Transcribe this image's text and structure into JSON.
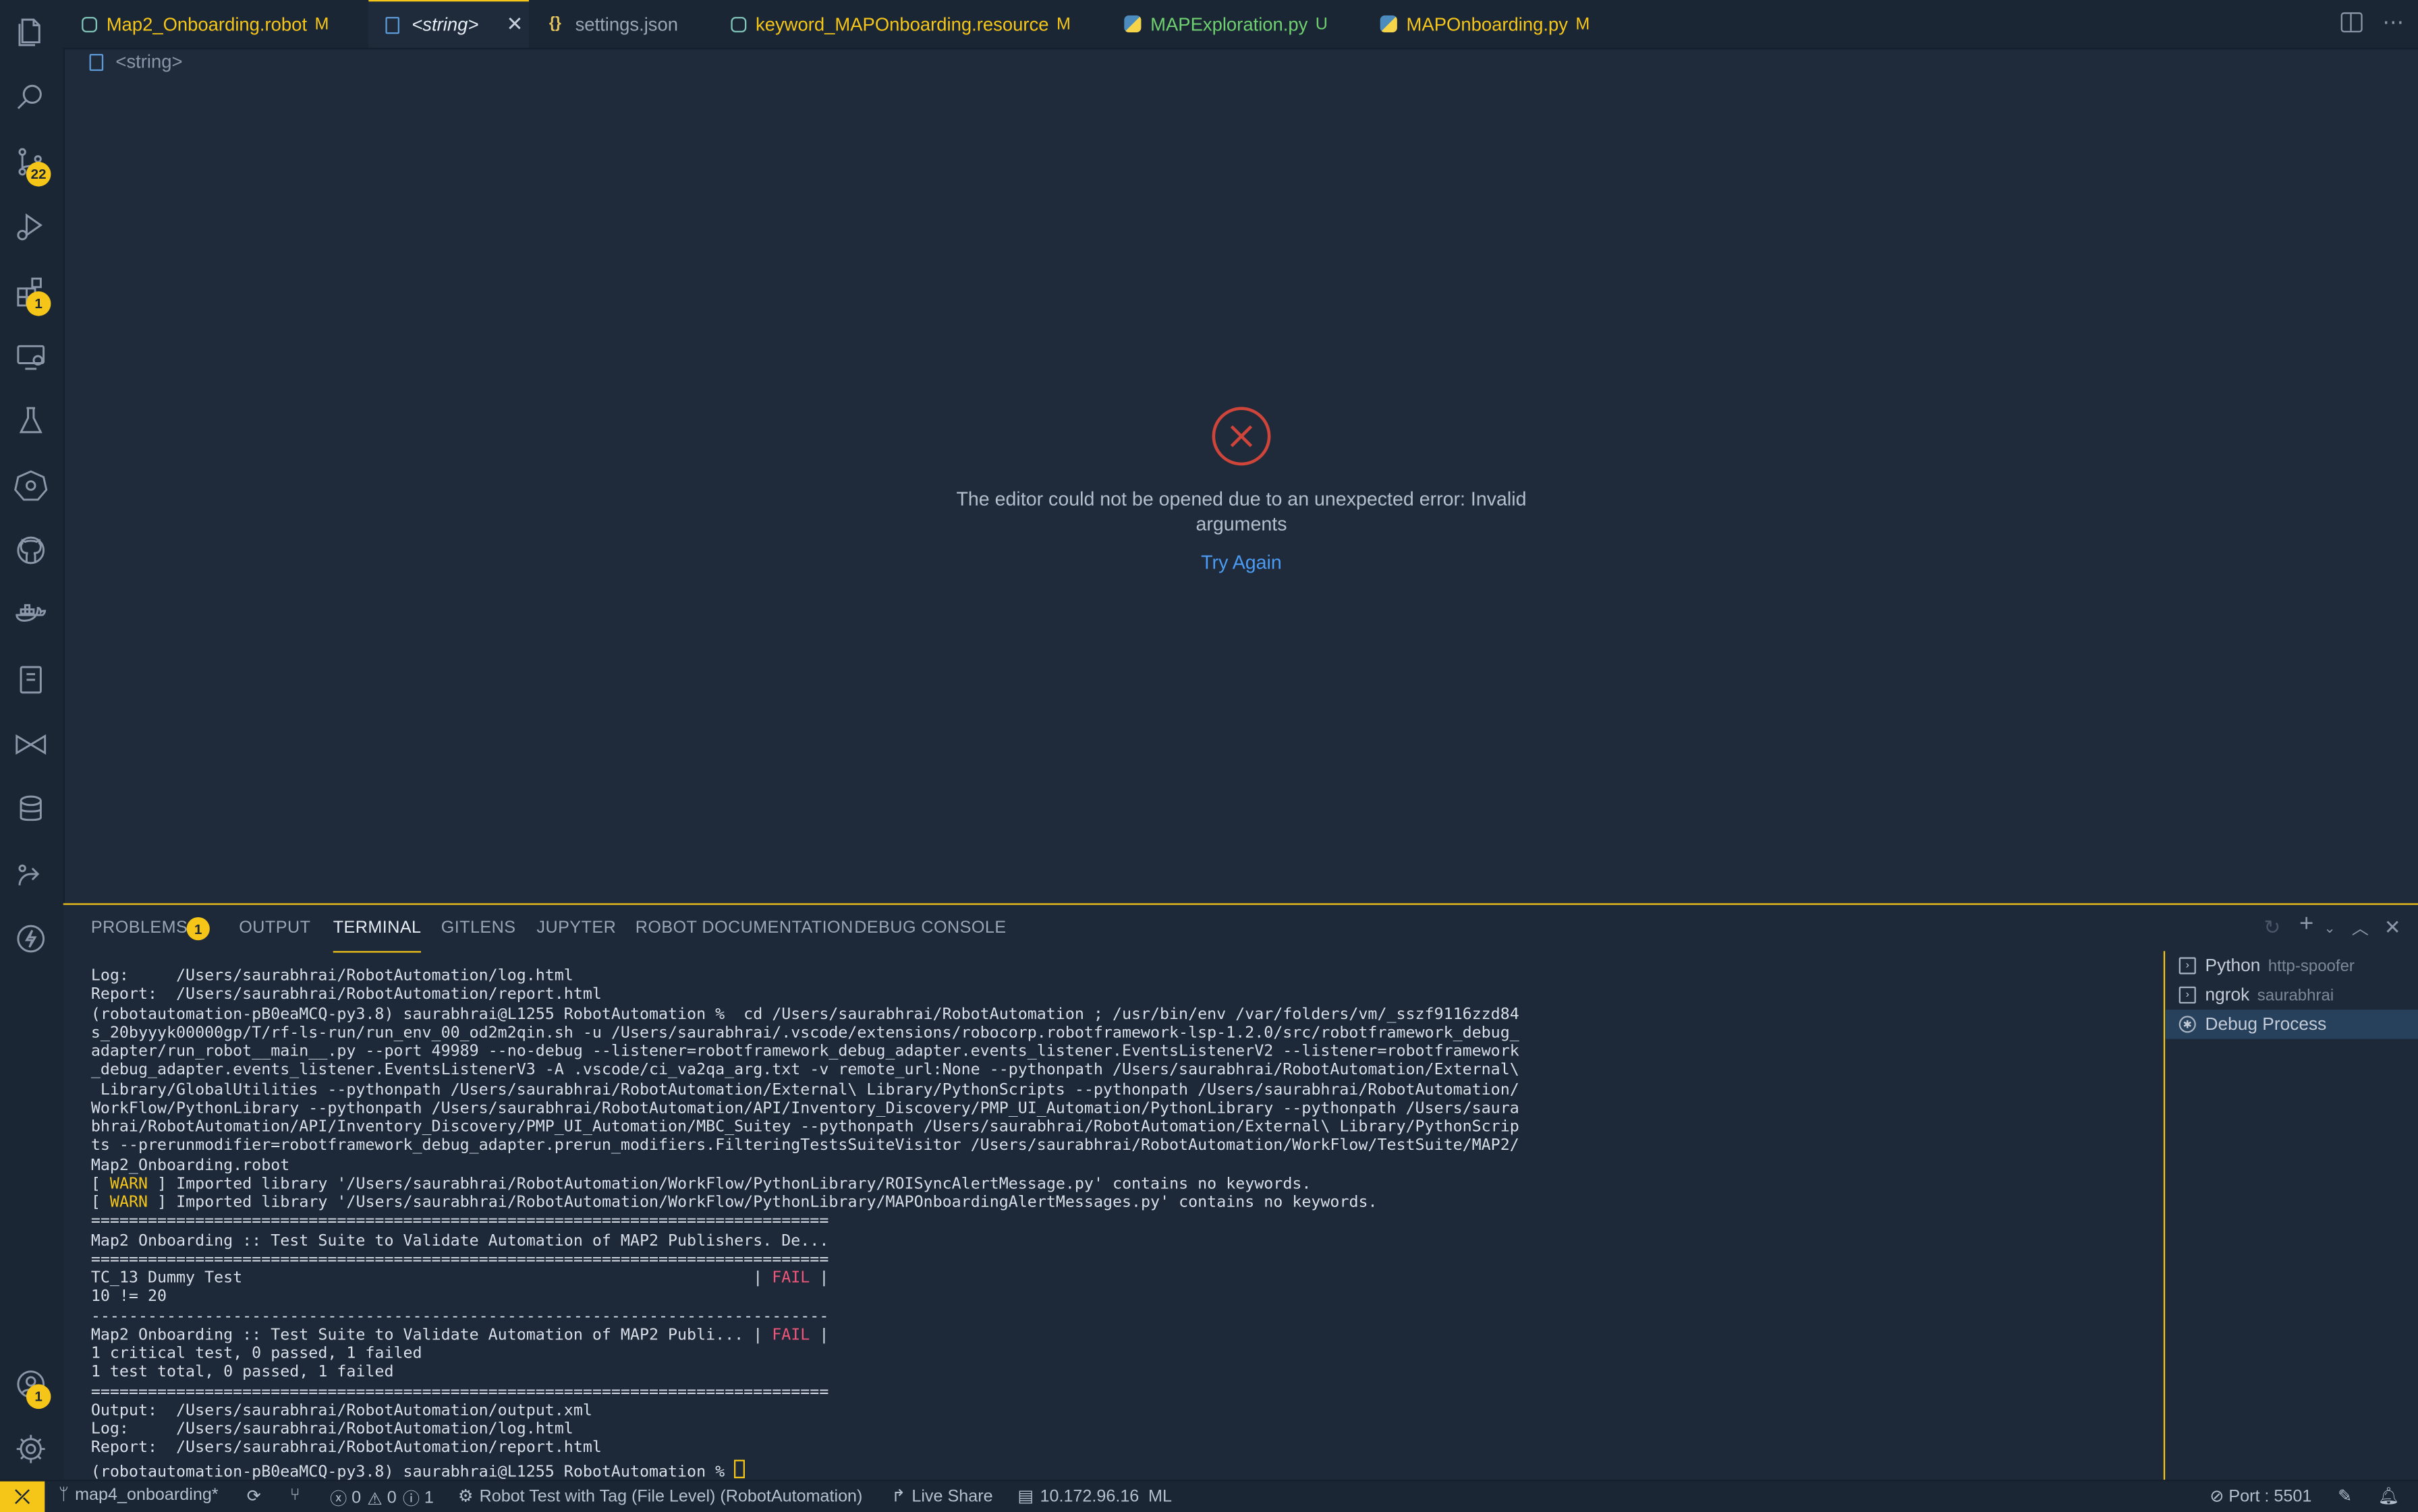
{
  "activity": {
    "scm_badge": "22",
    "extensions_badge": "1",
    "accounts_badge": "1"
  },
  "tabs": [
    {
      "label": "Map2_Onboarding.robot",
      "mod": "M",
      "color": "#f5c518"
    },
    {
      "label": "<string>",
      "mod": "",
      "color": "#e6ecf4"
    },
    {
      "label": "settings.json",
      "mod": "",
      "color": "#9aa6b6"
    },
    {
      "label": "keyword_MAPOnboarding.resource",
      "mod": "M",
      "color": "#f5c518"
    },
    {
      "label": "MAPExploration.py",
      "mod": "U",
      "color": "#6fd06f"
    },
    {
      "label": "MAPOnboarding.py",
      "mod": "M",
      "color": "#f5c518"
    }
  ],
  "breadcrumb": "<string>",
  "error": {
    "message_line1": "The editor could not be opened due to an unexpected error: Invalid",
    "message_line2": "arguments",
    "retry_label": "Try Again"
  },
  "panel": {
    "tabs": [
      "PROBLEMS",
      "OUTPUT",
      "TERMINAL",
      "GITLENS",
      "JUPYTER",
      "ROBOT DOCUMENTATION",
      "DEBUG CONSOLE"
    ],
    "problems_count": "1",
    "terminal_lines": [
      "Log:     /Users/saurabhrai/RobotAutomation/log.html",
      "Report:  /Users/saurabhrai/RobotAutomation/report.html",
      "(robotautomation-pB0eaMCQ-py3.8) saurabhrai@L1255 RobotAutomation %  cd /Users/saurabhrai/RobotAutomation ; /usr/bin/env /var/folders/vm/_sszf9116zzd84",
      "s_20byyyk00000gp/T/rf-ls-run/run_env_00_od2m2qin.sh -u /Users/saurabhrai/.vscode/extensions/robocorp.robotframework-lsp-1.2.0/src/robotframework_debug_",
      "adapter/run_robot__main__.py --port 49989 --no-debug --listener=robotframework_debug_adapter.events_listener.EventsListenerV2 --listener=robotframework",
      "_debug_adapter.events_listener.EventsListenerV3 -A .vscode/ci_va2qa_arg.txt -v remote_url:None --pythonpath /Users/saurabhrai/RobotAutomation/External\\",
      " Library/GlobalUtilities --pythonpath /Users/saurabhrai/RobotAutomation/External\\ Library/PythonScripts --pythonpath /Users/saurabhrai/RobotAutomation/",
      "WorkFlow/PythonLibrary --pythonpath /Users/saurabhrai/RobotAutomation/API/Inventory_Discovery/PMP_UI_Automation/PythonLibrary --pythonpath /Users/saura",
      "bhrai/RobotAutomation/API/Inventory_Discovery/PMP_UI_Automation/MBC_Suitey --pythonpath /Users/saurabhrai/RobotAutomation/External\\ Library/PythonScrip",
      "ts --prerunmodifier=robotframework_debug_adapter.prerun_modifiers.FilteringTestsSuiteVisitor /Users/saurabhrai/RobotAutomation/WorkFlow/TestSuite/MAP2/",
      "Map2_Onboarding.robot"
    ],
    "warn_label": "WARN",
    "warn_lines": [
      " ] Imported library '/Users/saurabhrai/RobotAutomation/WorkFlow/PythonLibrary/ROISyncAlertMessage.py' contains no keywords.",
      " ] Imported library '/Users/saurabhrai/RobotAutomation/WorkFlow/PythonLibrary/MAPOnboardingAlertMessages.py' contains no keywords."
    ],
    "sep_double": "==============================================================================",
    "sep_single": "------------------------------------------------------------------------------",
    "suite_header": "Map2 Onboarding :: Test Suite to Validate Automation of MAP2 Publishers. De...",
    "test_name": "TC_13 Dummy Test                                                      | ",
    "fail_label": "FAIL",
    "test_msg": "10 != 20",
    "suite_result": "Map2 Onboarding :: Test Suite to Validate Automation of MAP2 Publi... | ",
    "summary_1": "1 critical test, 0 passed, 1 failed",
    "summary_2": "1 test total, 0 passed, 1 failed",
    "out_output": "Output:  /Users/saurabhrai/RobotAutomation/output.xml",
    "out_log": "Log:     /Users/saurabhrai/RobotAutomation/log.html",
    "out_report": "Report:  /Users/saurabhrai/RobotAutomation/report.html",
    "prompt": "(robotautomation-pB0eaMCQ-py3.8) saurabhrai@L1255 RobotAutomation % ",
    "terminals": [
      {
        "name": "Python",
        "sub": "http-spoofer"
      },
      {
        "name": "ngrok",
        "sub": "saurabhrai"
      },
      {
        "name": "Debug Process",
        "sub": ""
      }
    ]
  },
  "status": {
    "branch": "map4_onboarding*",
    "errors": "0",
    "warnings": "0",
    "info": "1",
    "run_label": "Robot Test with Tag (File Level) (RobotAutomation)",
    "live_share": "Live Share",
    "ip": "10.172.96.16",
    "ml": "ML",
    "port": "Port : 5501"
  }
}
